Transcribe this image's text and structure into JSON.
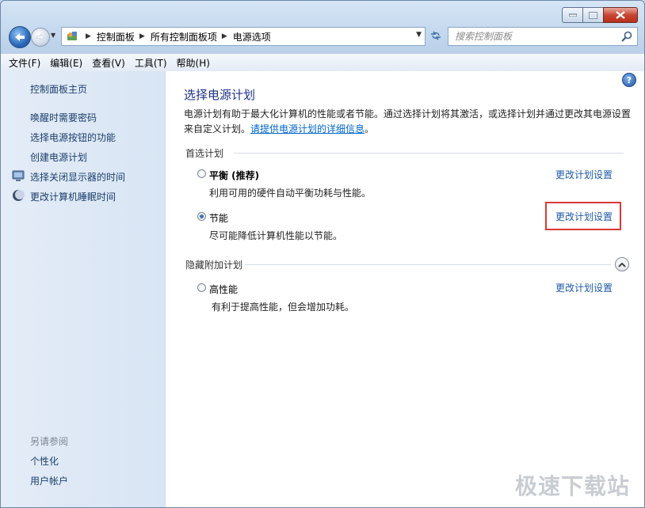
{
  "nav": {
    "breadcrumbs": [
      "控制面板",
      "所有控制面板项",
      "电源选项"
    ],
    "search_placeholder": "搜索控制面板"
  },
  "menubar": [
    "文件(F)",
    "编辑(E)",
    "查看(V)",
    "工具(T)",
    "帮助(H)"
  ],
  "sidebar": {
    "home": "控制面板主页",
    "links": [
      "唤醒时需要密码",
      "选择电源按钮的功能",
      "创建电源计划",
      "选择关闭显示器的时间",
      "更改计算机睡眠时间"
    ],
    "see_also_heading": "另请参阅",
    "see_also": [
      "个性化",
      "用户帐户"
    ]
  },
  "main": {
    "title": "选择电源计划",
    "desc_text": "电源计划有助于最大化计算机的性能或者节能。通过选择计划将其激活，或选择计划并通过更改其电源设置来自定义计划。",
    "desc_link": "请提供电源计划的详细信息",
    "desc_end": "。",
    "preferred_heading": "首选计划",
    "hidden_heading": "隐藏附加计划",
    "plans": [
      {
        "name": "平衡 (推荐)",
        "desc": "利用可用的硬件自动平衡功耗与性能。",
        "link": "更改计划设置",
        "selected": false
      },
      {
        "name": "节能",
        "desc": "尽可能降低计算机性能以节能。",
        "link": "更改计划设置",
        "selected": true
      },
      {
        "name": "高性能",
        "desc": "有利于提高性能，但会增加功耗。",
        "link": "更改计划设置",
        "selected": false
      }
    ],
    "help_label": "?"
  },
  "watermark": "极速下载站",
  "colors": {
    "link": "#1e5aa8",
    "title": "#1e3287",
    "highlight": "#d93a34"
  }
}
